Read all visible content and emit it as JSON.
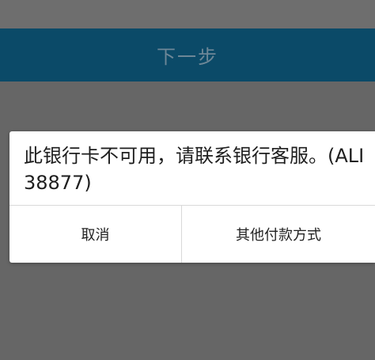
{
  "header": {
    "next_step_label": "下一步"
  },
  "dialog": {
    "message": "此银行卡不可用，请联系银行客服。(ALI38877)",
    "cancel_label": "取消",
    "other_payment_label": "其他付款方式"
  },
  "colors": {
    "primary_bar": "#0b4a68",
    "overlay": "#666666",
    "dialog_bg": "#ffffff"
  }
}
